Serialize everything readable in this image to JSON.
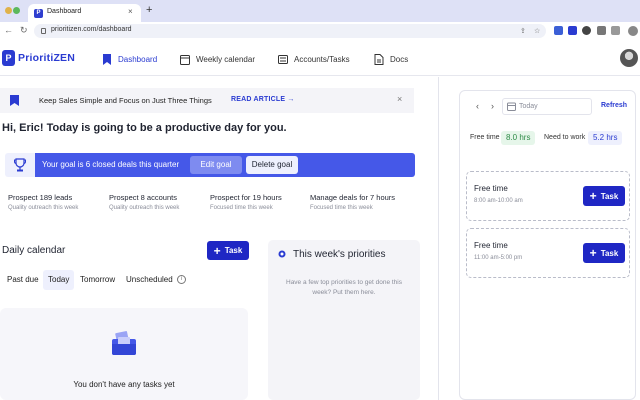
{
  "browser": {
    "tab_title": "Dashboard",
    "tab_close": "×",
    "new_tab": "+",
    "url": "prioritizen.com/dashboard",
    "back": "←",
    "forward": "→",
    "reload": "↻"
  },
  "app": {
    "logo_letter": "P",
    "logo_text": "PrioritiZEN",
    "accent_color": "#2a3bd1",
    "nav": [
      {
        "label": "Dashboard",
        "icon": "bookmark-icon",
        "active": true
      },
      {
        "label": "Weekly calendar",
        "icon": "calendar-icon",
        "active": false
      },
      {
        "label": "Accounts/Tasks",
        "icon": "list-icon",
        "active": false
      },
      {
        "label": "Docs",
        "icon": "document-icon",
        "active": false
      }
    ]
  },
  "banner": {
    "text": "Keep Sales Simple and Focus on Just Three Things",
    "link": "READ ARTICLE",
    "arrow": "→",
    "close": "×"
  },
  "greeting": "Hi, Eric! Today is going to be a productive day for you.",
  "goal": {
    "text": "Your goal is 6 closed deals this quarter",
    "edit": "Edit goal",
    "delete": "Delete goal"
  },
  "stats": [
    {
      "title": "Prospect 189 leads",
      "sub": "Quality outreach this week"
    },
    {
      "title": "Prospect 8 accounts",
      "sub": "Quality outreach this week"
    },
    {
      "title": "Prospect for 19 hours",
      "sub": "Focused time this week"
    },
    {
      "title": "Manage deals for 7 hours",
      "sub": "Focused time this week"
    }
  ],
  "daily": {
    "title": "Daily calendar",
    "add_task": "Task",
    "add_symbol": "+",
    "filters": [
      "Past due",
      "Today",
      "Tomorrow",
      "Unscheduled"
    ],
    "active_filter": "Today",
    "info": "i",
    "empty": "You don't have any tasks yet"
  },
  "priorities": {
    "title": "This week's priorities",
    "help": "Have a few top priorities to get done this week? Put them here."
  },
  "right": {
    "prev": "‹",
    "next": "›",
    "date_placeholder": "Today",
    "refresh": "Refresh",
    "free_time_label": "Free time",
    "free_time_value": "8.0 hrs",
    "need_label": "Need to work",
    "need_value": "5.2 hrs",
    "slots": [
      {
        "title": "Free time",
        "time": "8:00 am-10:00 am",
        "button": "Task"
      },
      {
        "title": "Free time",
        "time": "11:00 am-5:00 pm",
        "button": "Task"
      }
    ]
  }
}
